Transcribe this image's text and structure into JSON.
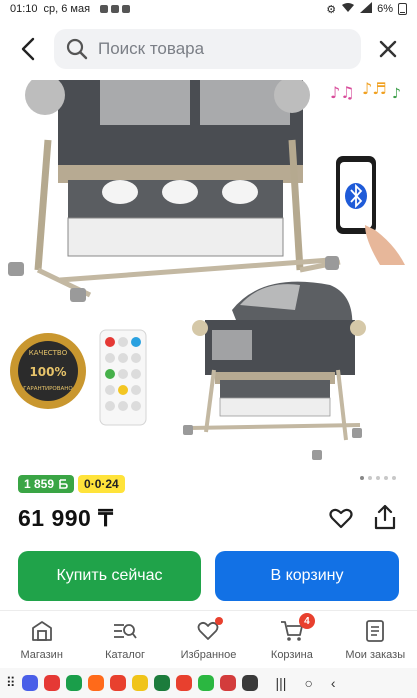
{
  "status_bar": {
    "time": "01:10",
    "date": "ср, 6 мая",
    "battery": "6%"
  },
  "header": {
    "search_placeholder": "Поиск товара",
    "back_icon": "back-arrow-icon",
    "close_icon": "close-icon"
  },
  "product": {
    "quality_badge_top": "КАЧЕСТВО",
    "quality_badge_value": "100%",
    "quality_badge_bottom": "ГАРАНТИРОВАНО",
    "points": "1 859",
    "installment": "0·0·24",
    "price": "61 990 ₸",
    "carousel_count": 5,
    "carousel_active": 0
  },
  "actions": {
    "buy_now": "Купить сейчас",
    "to_cart": "В корзину"
  },
  "bottom_nav": {
    "items": [
      {
        "label": "Магазин",
        "icon": "shop-icon"
      },
      {
        "label": "Каталог",
        "icon": "catalog-icon"
      },
      {
        "label": "Избранное",
        "icon": "heart-icon"
      },
      {
        "label": "Корзина",
        "icon": "cart-icon",
        "count": "4"
      },
      {
        "label": "Мои заказы",
        "icon": "orders-icon"
      }
    ]
  },
  "colors": {
    "green": "#20a34a",
    "blue": "#1271e5",
    "yellow": "#ffe33a",
    "red_dot": "#e8402e"
  }
}
